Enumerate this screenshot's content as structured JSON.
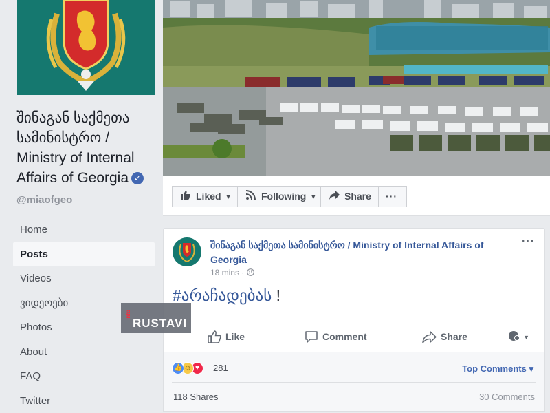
{
  "page": {
    "name": "შინაგან საქმეთა სამინისტრო / Ministry of Internal Affairs of Georgia",
    "name_line1": "შინაგან საქმეთა",
    "name_line2": "სამინისტრო /",
    "name_line3": "Ministry of Internal",
    "name_line4": "Affairs of Georgia",
    "handle": "@miaofgeo",
    "verified_icon": "verified-check-icon"
  },
  "nav": {
    "items": [
      {
        "label": "Home"
      },
      {
        "label": "Posts"
      },
      {
        "label": "Videos"
      },
      {
        "label": "ვიდეოები"
      },
      {
        "label": "Photos"
      },
      {
        "label": "About"
      },
      {
        "label": "FAQ"
      },
      {
        "label": "Twitter"
      }
    ],
    "active": "Posts"
  },
  "watermark": {
    "small": "Info",
    "big": "RUSTAVI"
  },
  "actions": {
    "liked": "Liked",
    "following": "Following",
    "share": "Share",
    "more": "···"
  },
  "post": {
    "author": "შინაგან საქმეთა სამინისტრო / Ministry of Internal Affairs of Georgia",
    "time": "18 mins",
    "separator": "·",
    "text": "#არაჩადებას",
    "text_suffix": "!",
    "more": "···",
    "like": "Like",
    "comment": "Comment",
    "share": "Share"
  },
  "reactions": {
    "count": "281",
    "top_comments": "Top Comments ▾",
    "shares": "118 Shares",
    "comments": "30 Comments"
  },
  "colors": {
    "link": "#365899",
    "brand": "#4267b2",
    "emblem_bg": "#15786f"
  }
}
